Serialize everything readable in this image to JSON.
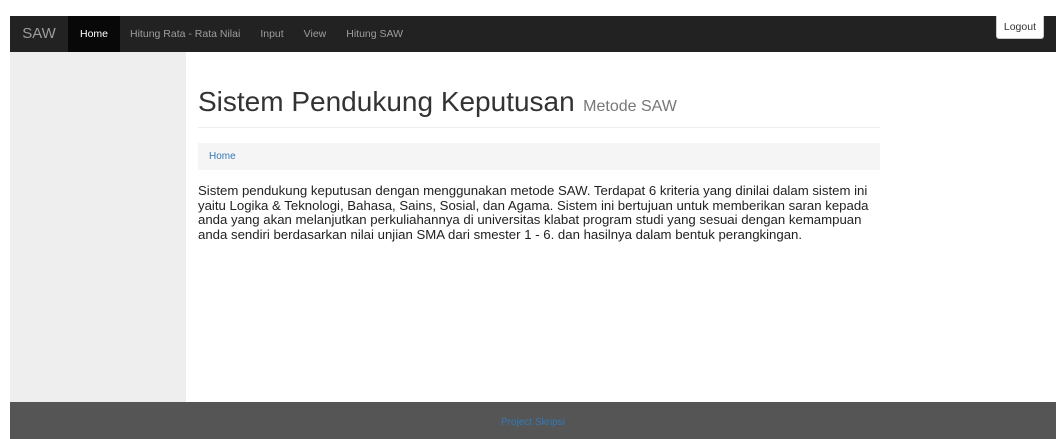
{
  "navbar": {
    "brand": "SAW",
    "links": [
      {
        "label": "Home",
        "active": true
      },
      {
        "label": "Hitung Rata - Rata Nilai",
        "active": false
      },
      {
        "label": "Input",
        "active": false
      },
      {
        "label": "View",
        "active": false
      },
      {
        "label": "Hitung SAW",
        "active": false
      }
    ],
    "logout_label": "Logout"
  },
  "main": {
    "title": "Sistem Pendukung Keputusan",
    "subtitle": "Metode SAW",
    "breadcrumb": [
      "Home"
    ],
    "description": "Sistem pendukung keputusan dengan menggunakan metode SAW. Terdapat 6 kriteria yang dinilai dalam sistem ini yaitu Logika & Teknologi, Bahasa, Sains, Sosial, dan Agama. Sistem ini bertujuan untuk memberikan saran kepada anda yang akan melanjutkan perkuliahannya di universitas klabat program studi yang sesuai dengan kemampuan anda sendiri berdasarkan nilai unjian SMA dari smester 1 - 6. dan hasilnya dalam bentuk perangkingan."
  },
  "footer": {
    "text": "Project Skripsi"
  },
  "colors": {
    "navbar_bg": "#222222",
    "sidebar_bg": "#eeeeee",
    "footer_bg": "#555555",
    "link": "#337ab7"
  }
}
